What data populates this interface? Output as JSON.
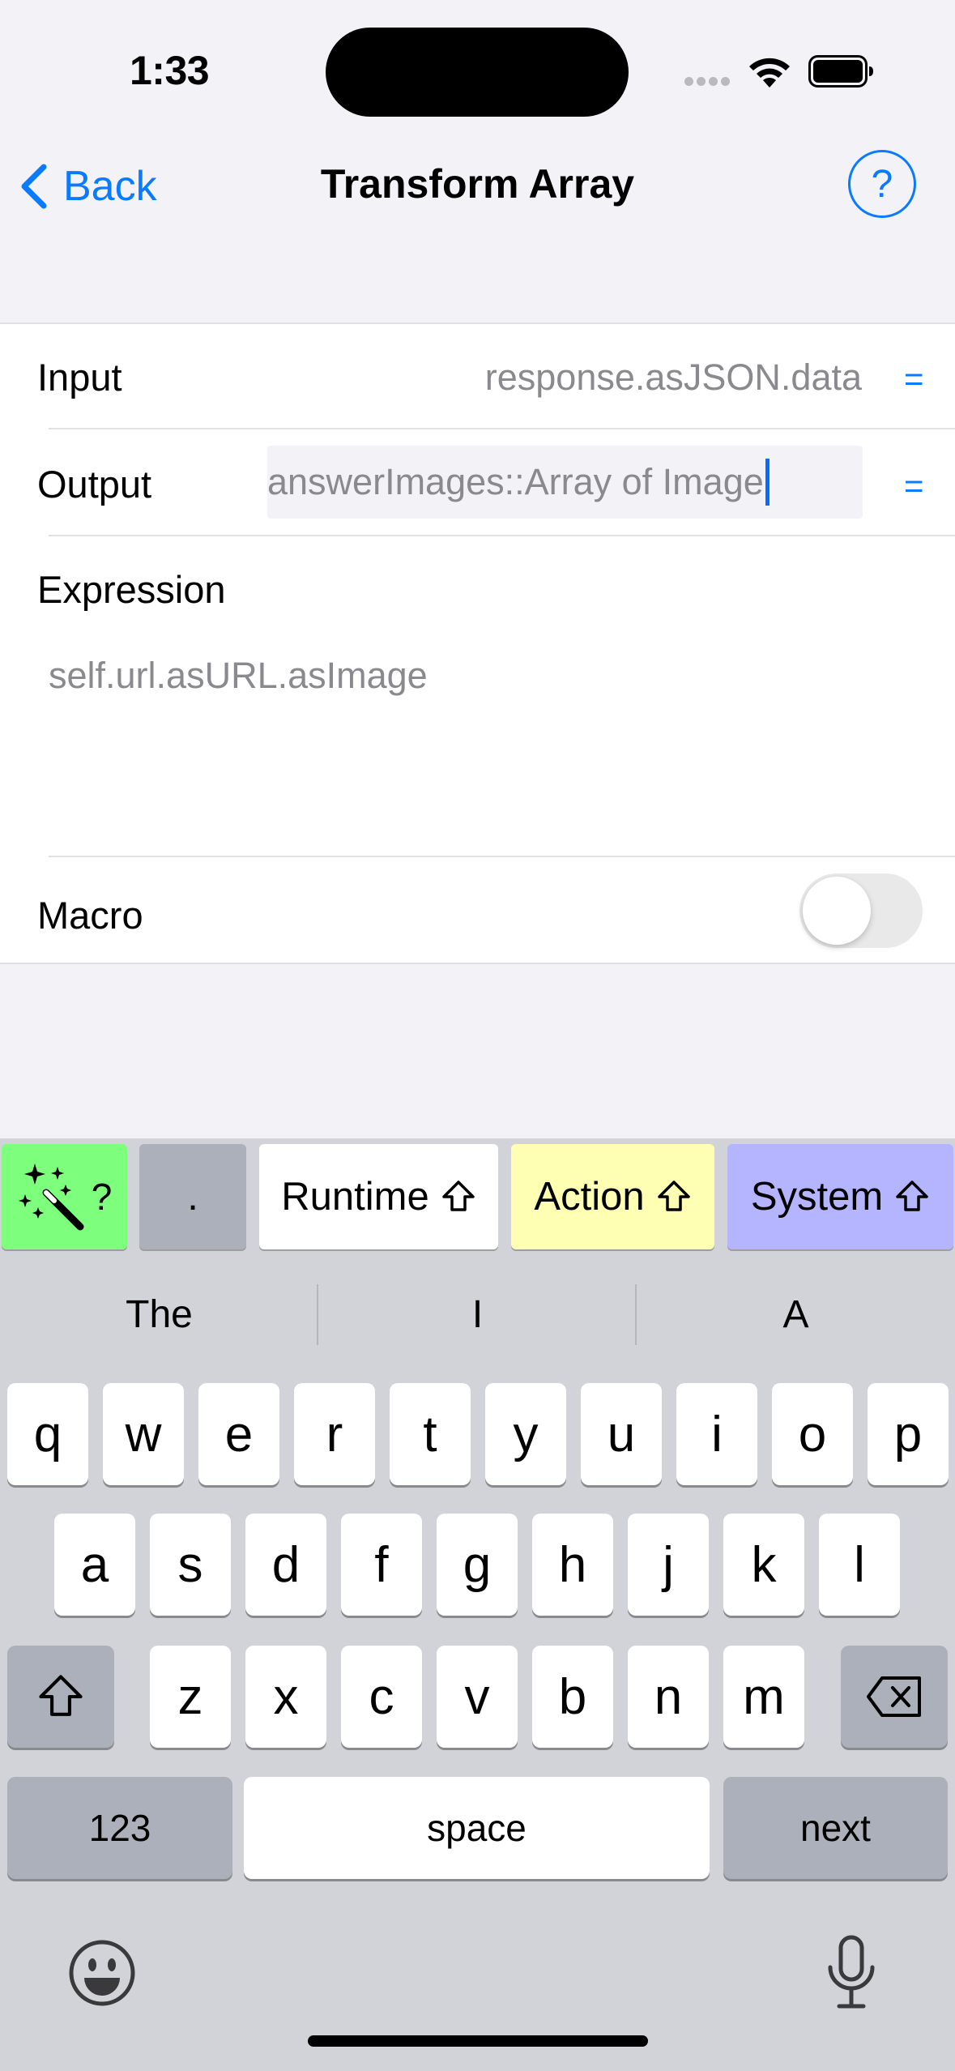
{
  "status_bar": {
    "time": "1:33"
  },
  "nav": {
    "back_label": "Back",
    "title": "Transform Array",
    "help_label": "?"
  },
  "form": {
    "input": {
      "label": "Input",
      "value": "response.asJSON.data",
      "eq": "="
    },
    "output": {
      "label": "Output",
      "value": "answerImages::Array of Image",
      "eq": "="
    },
    "expression": {
      "label": "Expression",
      "value": "self.url.asURL.asImage"
    },
    "macro": {
      "label": "Macro",
      "enabled": false
    }
  },
  "accessory_bar": {
    "magic": "?",
    "dot": ".",
    "runtime": "Runtime",
    "action": "Action",
    "system": "System",
    "colors": {
      "magic": "#7dff7d",
      "dot": "#abb0ba",
      "runtime": "#ffffff",
      "action": "#ffffb4",
      "system": "#b4b4ff"
    }
  },
  "suggestions": [
    "The",
    "I",
    "A"
  ],
  "keyboard": {
    "row1": [
      "q",
      "w",
      "e",
      "r",
      "t",
      "y",
      "u",
      "i",
      "o",
      "p"
    ],
    "row2": [
      "a",
      "s",
      "d",
      "f",
      "g",
      "h",
      "j",
      "k",
      "l"
    ],
    "row3": [
      "z",
      "x",
      "c",
      "v",
      "b",
      "n",
      "m"
    ],
    "numbers_label": "123",
    "space_label": "space",
    "return_label": "next"
  },
  "icons": {
    "back": "chevron-left-icon",
    "help": "question-circle-icon",
    "wifi": "wifi-icon",
    "battery": "battery-icon",
    "shift": "shift-icon",
    "delete": "delete-icon",
    "emoji": "emoji-icon",
    "mic": "mic-icon",
    "magic": "magic-wand-icon"
  }
}
